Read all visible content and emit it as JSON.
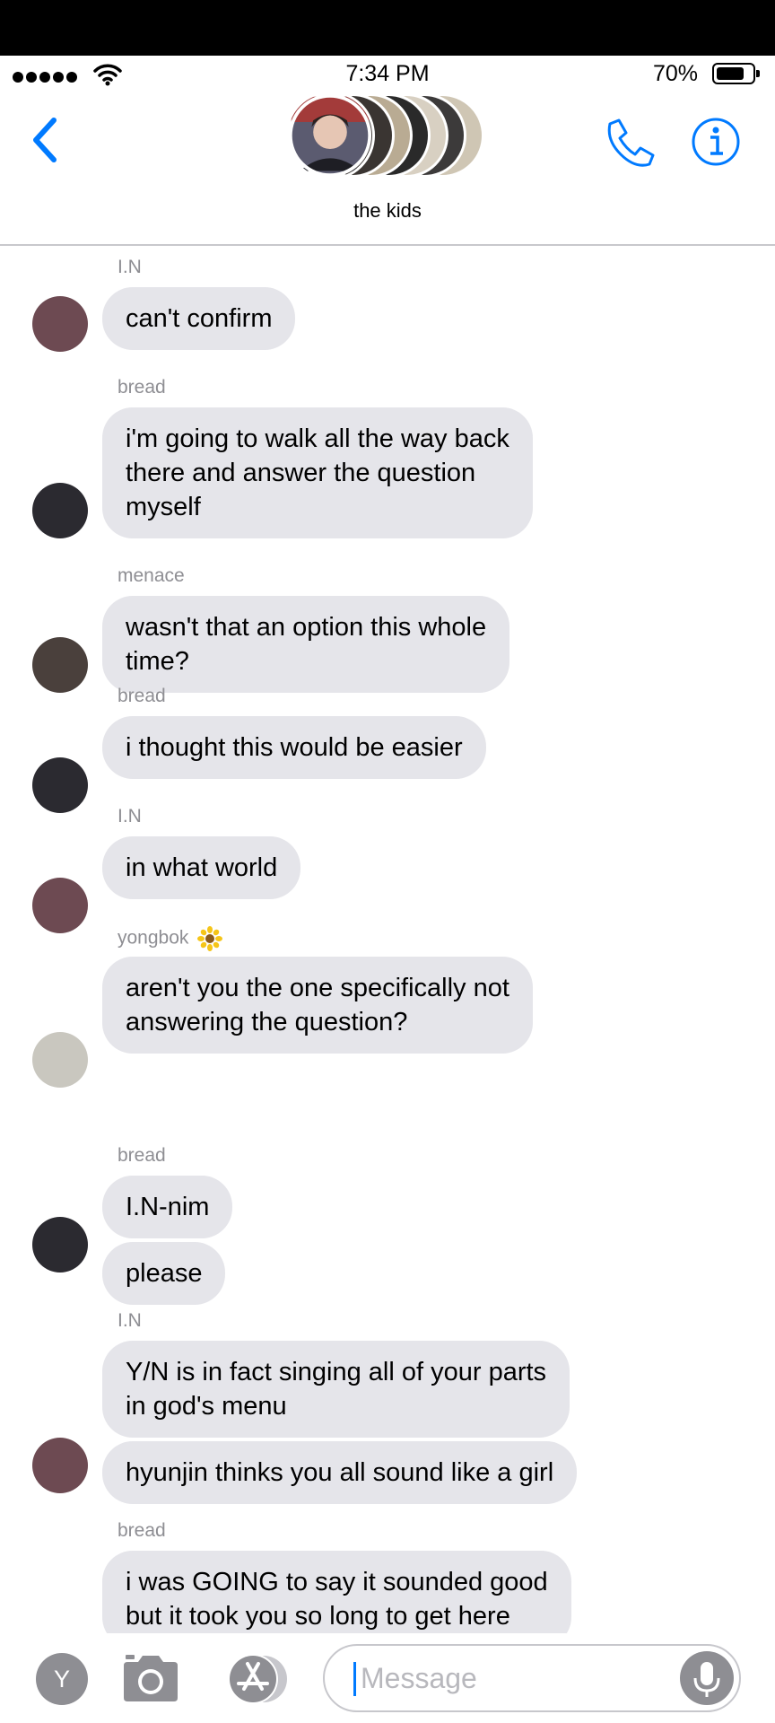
{
  "status_bar": {
    "time": "7:34 PM",
    "battery": "70%"
  },
  "header": {
    "group_name": "the kids"
  },
  "messages": [
    {
      "sender": "I.N",
      "bubbles": [
        "can't confirm"
      ]
    },
    {
      "sender": "bread",
      "bubbles": [
        "i'm going to walk all the way back\nthere and answer the question\nmyself"
      ]
    },
    {
      "sender": "menace",
      "bubbles": [
        "wasn't that an option this whole\ntime?"
      ]
    },
    {
      "sender": "bread",
      "bubbles": [
        "i thought this would be easier"
      ]
    },
    {
      "sender": "I.N",
      "bubbles": [
        "in what world"
      ]
    },
    {
      "sender": "yongbok",
      "bubbles": [
        "aren't you the one specifically not\nanswering the question?"
      ]
    },
    {
      "sender": "bread",
      "bubbles": [
        "I.N-nim",
        "please"
      ]
    },
    {
      "sender": "I.N",
      "bubbles": [
        "Y/N is in fact singing all of your parts\nin god's menu",
        "hyunjin thinks you all sound like a girl"
      ]
    },
    {
      "sender": "bread",
      "bubbles": [
        "i was GOING to say it sounded good\nbut it took you so long to get here"
      ]
    }
  ],
  "composer": {
    "apps_label": "Y",
    "placeholder": "Message"
  },
  "icons": {
    "back": "chevron-left-icon",
    "call": "phone-icon",
    "info": "info-icon",
    "camera": "camera-icon",
    "app_store": "app-store-icon",
    "mic": "microphone-icon",
    "sender_badge": "sunflower-icon"
  },
  "colors": {
    "accent": "#007aff",
    "bubble": "#e5e5ea",
    "meta_text": "#8e8e93"
  }
}
